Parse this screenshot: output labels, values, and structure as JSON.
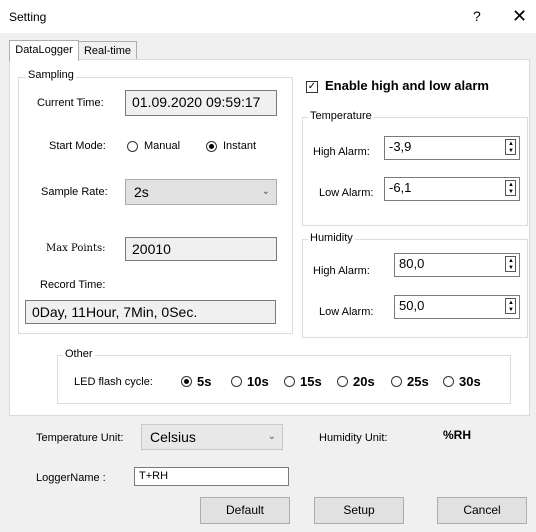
{
  "window": {
    "title": "Setting",
    "help_label": "?",
    "close_label": "✕"
  },
  "tabs": [
    {
      "label": "DataLogger"
    },
    {
      "label": "Real-time"
    }
  ],
  "sampling": {
    "legend": "Sampling",
    "current_time_label": "Current Time:",
    "current_time_value": "01.09.2020 09:59:17",
    "start_mode_label": "Start Mode:",
    "start_mode_options": [
      "Manual",
      "Instant"
    ],
    "start_mode_selected": "Instant",
    "sample_rate_label": "Sample Rate:",
    "sample_rate_value": "2s",
    "max_points_label": "Max Points:",
    "max_points_value": "20010",
    "record_time_label": "Record Time:",
    "record_time_value": "0Day, 11Hour, 7Min, 0Sec."
  },
  "alarm": {
    "enable_label": "Enable high and low alarm",
    "enabled": true,
    "temperature": {
      "legend": "Temperature",
      "high_label": "High Alarm:",
      "high_value": "-3,9",
      "low_label": "Low Alarm:",
      "low_value": "-6,1"
    },
    "humidity": {
      "legend": "Humidity",
      "high_label": "High Alarm:",
      "high_value": "80,0",
      "low_label": "Low Alarm:",
      "low_value": "50,0"
    }
  },
  "other": {
    "legend": "Other",
    "led_label": "LED flash cycle:",
    "led_options": [
      "5s",
      "10s",
      "15s",
      "20s",
      "25s",
      "30s"
    ],
    "led_selected": "5s"
  },
  "bottom": {
    "temp_unit_label": "Temperature Unit:",
    "temp_unit_value": "Celsius",
    "humidity_unit_label": "Humidity Unit:",
    "humidity_unit_value": "%RH",
    "logger_name_label": "LoggerName :",
    "logger_name_value": "T+RH"
  },
  "buttons": {
    "default": "Default",
    "setup": "Setup",
    "cancel": "Cancel"
  },
  "icons": {
    "check": "check-icon",
    "chevron": "chevron-down-icon",
    "spin": "spin-icon"
  }
}
